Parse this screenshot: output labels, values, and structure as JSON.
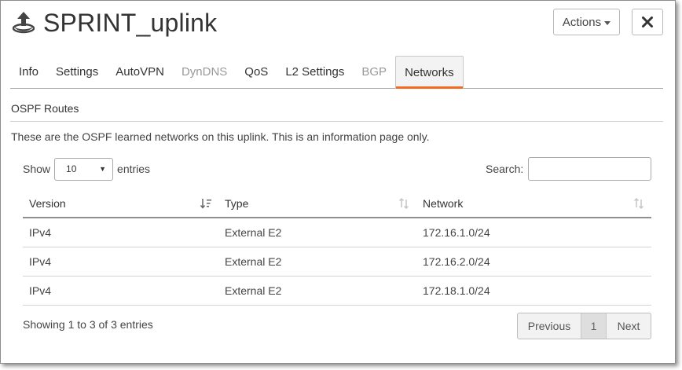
{
  "header": {
    "title": "SPRINT_uplink",
    "icon": "uplink-icon"
  },
  "toolbar": {
    "actions_label": "Actions",
    "close_icon": "close-icon"
  },
  "tabs": [
    {
      "label": "Info",
      "state": "normal"
    },
    {
      "label": "Settings",
      "state": "normal"
    },
    {
      "label": "AutoVPN",
      "state": "normal"
    },
    {
      "label": "DynDNS",
      "state": "disabled"
    },
    {
      "label": "QoS",
      "state": "normal"
    },
    {
      "label": "L2 Settings",
      "state": "normal"
    },
    {
      "label": "BGP",
      "state": "disabled"
    },
    {
      "label": "Networks",
      "state": "active"
    }
  ],
  "section": {
    "title": "OSPF Routes",
    "description": "These are the OSPF learned networks on this uplink. This is an information page only."
  },
  "controls": {
    "show_label": "Show",
    "page_size": "10",
    "entries_label": "entries",
    "search_label": "Search:",
    "search_value": ""
  },
  "table": {
    "columns": [
      "Version",
      "Type",
      "Network"
    ],
    "rows": [
      [
        "IPv4",
        "External E2",
        "172.16.1.0/24"
      ],
      [
        "IPv4",
        "External E2",
        "172.16.2.0/24"
      ],
      [
        "IPv4",
        "External E2",
        "172.18.1.0/24"
      ]
    ]
  },
  "footer": {
    "info": "Showing 1 to 3 of 3 entries",
    "previous_label": "Previous",
    "current_page": "1",
    "next_label": "Next"
  },
  "colors": {
    "accent": "#f26b21",
    "text": "#333333",
    "muted": "#999999"
  }
}
